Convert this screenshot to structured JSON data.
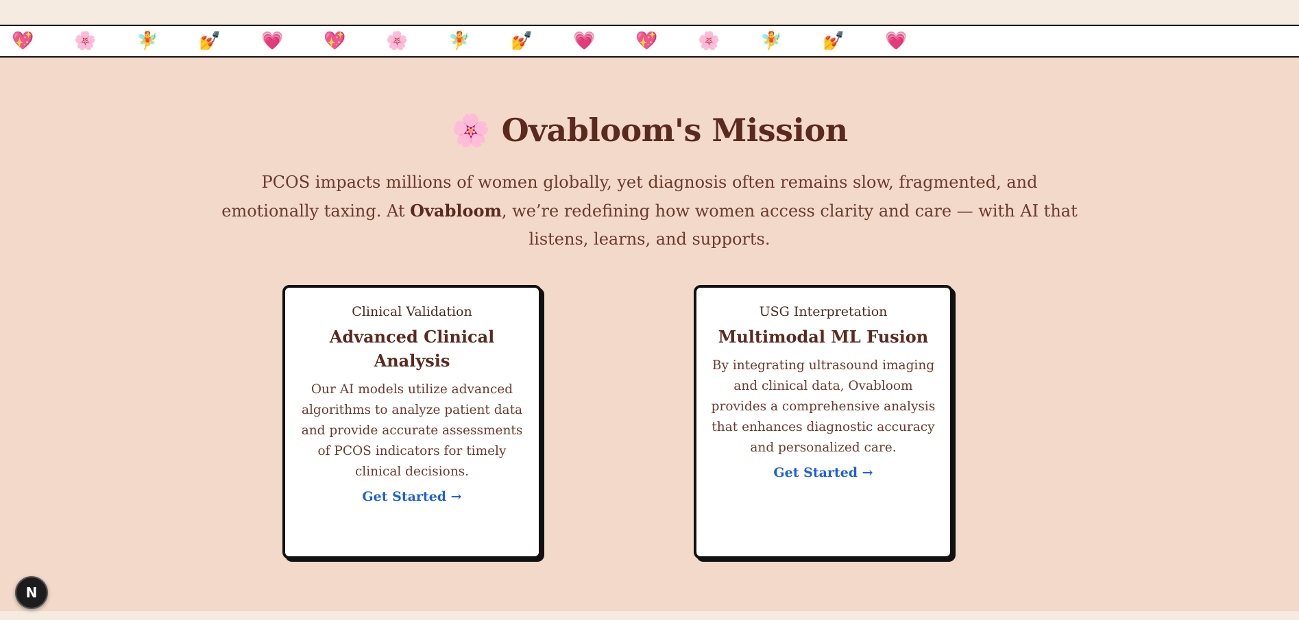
{
  "marquee": {
    "items": [
      "💖",
      "🌸",
      "🧚",
      "💅",
      "💗",
      "💖",
      "🌸",
      "🧚",
      "💅",
      "💗",
      "💖",
      "🌸",
      "🧚",
      "💅",
      "💗"
    ]
  },
  "mission": {
    "title_icon": "🌸",
    "title": "Ovabloom's Mission",
    "lead_before": "PCOS impacts millions of women globally, yet diagnosis often remains slow, fragmented, and emotionally taxing. At ",
    "lead_brand": "Ovabloom",
    "lead_after": ", we’re redefining how women access clarity and care — with AI that listens, learns, and supports."
  },
  "cards": [
    {
      "eyebrow": "Clinical Validation",
      "title": "Advanced Clinical Analysis",
      "description": "Our AI models utilize advanced algorithms to analyze patient data and provide accurate assessments of PCOS indicators for timely clinical decisions.",
      "link": "Get Started →"
    },
    {
      "eyebrow": "USG Interpretation",
      "title": "Multimodal ML Fusion",
      "description": "By integrating ultrasound imaging and clinical data, Ovabloom provides a comprehensive analysis that enhances diagnostic accuracy and personalized care.",
      "link": "Get Started →"
    }
  ],
  "badge": {
    "label": "N"
  }
}
